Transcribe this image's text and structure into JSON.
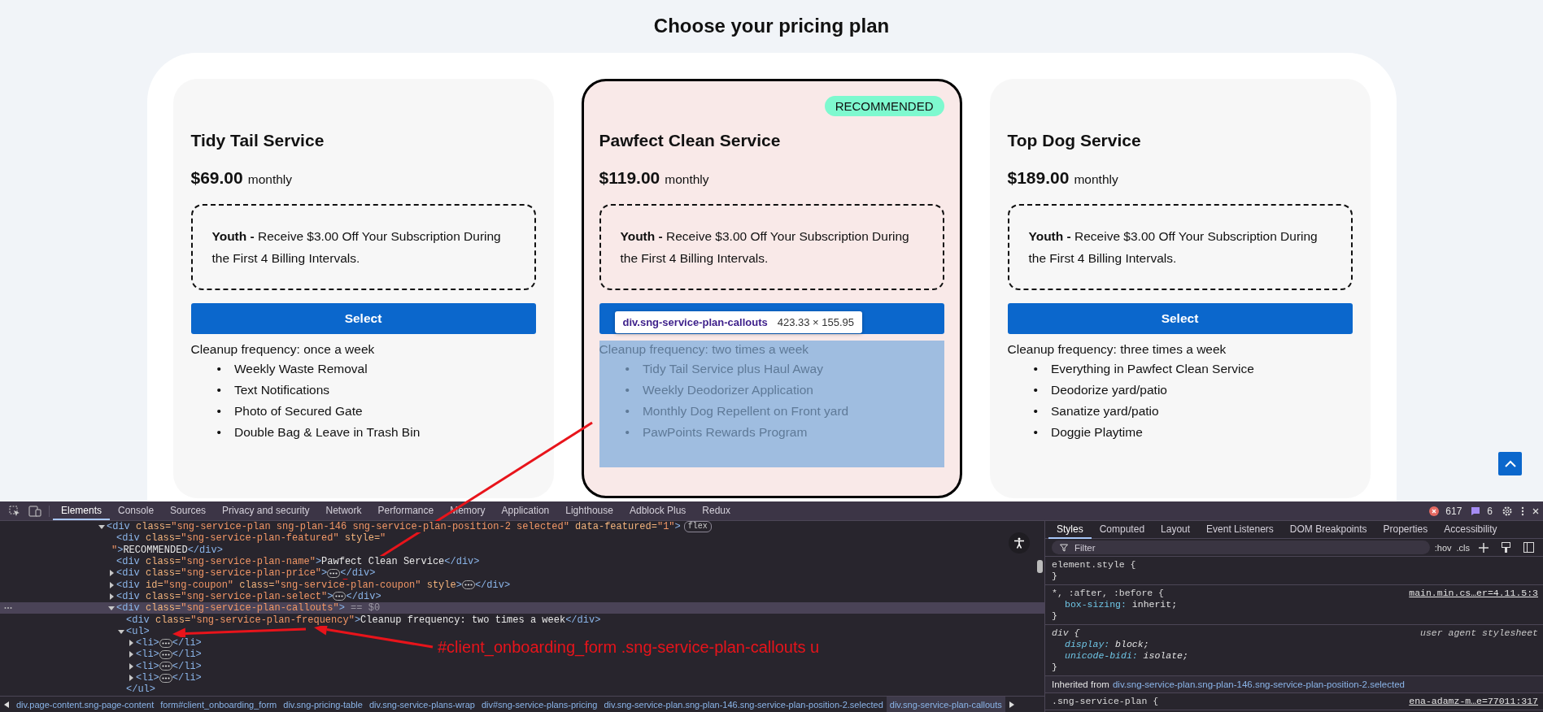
{
  "page": {
    "title": "Choose your pricing plan"
  },
  "plans": [
    {
      "name": "Tidy Tail Service",
      "price": "$69.00",
      "period": "monthly",
      "selected": false,
      "inspected": false,
      "coupon": "**Youth -** Receive $3.00 Off Your Subscription During the First 4 Billing Intervals.",
      "select_label": "Select",
      "frequency": "Cleanup frequency: once a week",
      "features": [
        {
          "bullet": "•",
          "text": "Weekly Waste Removal"
        },
        {
          "bullet": "•",
          "text": "Text Notifications"
        },
        {
          "bullet": "•",
          "text": "Photo of Secured Gate"
        },
        {
          "bullet": "•",
          "text": "Double Bag & Leave in Trash Bin"
        }
      ]
    },
    {
      "name": "Pawfect Clean Service",
      "price": "$119.00",
      "period": "monthly",
      "badge": "RECOMMENDED",
      "selected": true,
      "inspected": true,
      "coupon": "**Youth -** Receive $3.00 Off Your Subscription During the First 4 Billing Intervals.",
      "frequency": "Cleanup frequency: two times a week",
      "features": [
        {
          "bullet": "•",
          "text": "Tidy Tail Service plus Haul Away"
        },
        {
          "bullet": "•",
          "text": "Weekly Deodorizer Application"
        },
        {
          "bullet": "•",
          "text": "Monthly Dog Repellent on Front yard"
        },
        {
          "bullet": "•",
          "text": "PawPoints Rewards Program"
        }
      ]
    },
    {
      "name": "Top Dog Service",
      "price": "$189.00",
      "period": "monthly",
      "selected": false,
      "inspected": false,
      "coupon": "**Youth -** Receive $3.00 Off Your Subscription During the First 4 Billing Intervals.",
      "select_label": "Select",
      "frequency": "Cleanup frequency: three times a week",
      "features": [
        {
          "bullet": "•",
          "text": "Everything in Pawfect Clean Service"
        },
        {
          "bullet": "•",
          "text": "Deodorize yard/patio"
        },
        {
          "bullet": "•",
          "text": "Sanatize yard/patio"
        },
        {
          "bullet": "•",
          "text": "Doggie Playtime"
        }
      ]
    }
  ],
  "inspector_tooltip": {
    "selector": "div.sng-service-plan-callouts",
    "size": "423.33 × 155.95"
  },
  "annotation": {
    "text": "#client_onboarding_form .sng-service-plan-callouts u"
  },
  "devtools": {
    "tabs": [
      {
        "label": "Elements",
        "selected": true
      },
      {
        "label": "Console",
        "selected": false
      },
      {
        "label": "Sources",
        "selected": false
      },
      {
        "label": "Privacy and security",
        "selected": false
      },
      {
        "label": "Network",
        "selected": false
      },
      {
        "label": "Performance",
        "selected": false
      },
      {
        "label": "Memory",
        "selected": false
      },
      {
        "label": "Application",
        "selected": false
      },
      {
        "label": "Lighthouse",
        "selected": false
      },
      {
        "label": "Adblock Plus",
        "selected": false
      },
      {
        "label": "Redux",
        "selected": false
      }
    ],
    "error_count": "617",
    "message_count": "6",
    "dom_tree": [
      {
        "expanded": true,
        "selected": false,
        "lines": [
          [
            {
              "kind": "tag",
              "t": "<div"
            },
            {
              "kind": "attr",
              "t": " class="
            },
            {
              "kind": "value",
              "t": "\"sng-service-plan sng-plan-146 sng-service-plan-position-2 selected\""
            },
            {
              "kind": "attr",
              "t": " data-featured="
            },
            {
              "kind": "value",
              "t": "\"1\""
            },
            {
              "kind": "tag",
              "t": ">"
            },
            {
              "kind": "badge",
              "t": "flex"
            }
          ]
        ],
        "children": [
          {
            "selected": false,
            "lines": [
              [
                {
                  "kind": "tag",
                  "t": "<div"
                },
                {
                  "kind": "attr",
                  "t": " class="
                },
                {
                  "kind": "value",
                  "t": "\"sng-service-plan-featured\""
                },
                {
                  "kind": "attr",
                  "t": " style="
                },
                {
                  "kind": "value",
                  "t": "\""
                }
              ],
              [
                {
                  "kind": "value",
                  "t": "\""
                },
                {
                  "kind": "tag",
                  "t": ">"
                },
                {
                  "kind": "text",
                  "t": "RECOMMENDED"
                },
                {
                  "kind": "tag",
                  "t": "</div>"
                }
              ]
            ]
          },
          {
            "selected": false,
            "lines": [
              [
                {
                  "kind": "tag",
                  "t": "<div"
                },
                {
                  "kind": "attr",
                  "t": " class="
                },
                {
                  "kind": "value",
                  "t": "\"sng-service-plan-name\""
                },
                {
                  "kind": "tag",
                  "t": ">"
                },
                {
                  "kind": "text",
                  "t": "Pawfect Clean Service"
                },
                {
                  "kind": "tag",
                  "t": "</div>"
                }
              ]
            ]
          },
          {
            "expanded": false,
            "selected": false,
            "lines": [
              [
                {
                  "kind": "tag",
                  "t": "<div"
                },
                {
                  "kind": "attr",
                  "t": " class="
                },
                {
                  "kind": "value",
                  "t": "\"sng-service-plan-price\""
                },
                {
                  "kind": "tag",
                  "t": ">"
                },
                {
                  "kind": "more"
                },
                {
                  "kind": "tag",
                  "t": "</div>"
                }
              ]
            ]
          },
          {
            "expanded": false,
            "selected": false,
            "lines": [
              [
                {
                  "kind": "tag",
                  "t": "<div"
                },
                {
                  "kind": "attr",
                  "t": " id="
                },
                {
                  "kind": "value",
                  "t": "\"sng-coupon\""
                },
                {
                  "kind": "attr",
                  "t": " class="
                },
                {
                  "kind": "value",
                  "t": "\"sng-service-plan-coupon\""
                },
                {
                  "kind": "attr",
                  "t": " style"
                },
                {
                  "kind": "tag",
                  "t": ">"
                },
                {
                  "kind": "more"
                },
                {
                  "kind": "tag",
                  "t": "</div>"
                }
              ]
            ]
          },
          {
            "expanded": false,
            "selected": false,
            "lines": [
              [
                {
                  "kind": "tag",
                  "t": "<div"
                },
                {
                  "kind": "attr",
                  "t": " class="
                },
                {
                  "kind": "value",
                  "t": "\"sng-service-plan-select\""
                },
                {
                  "kind": "tag",
                  "t": ">"
                },
                {
                  "kind": "more"
                },
                {
                  "kind": "tag",
                  "t": "</div>"
                }
              ]
            ]
          },
          {
            "expanded": true,
            "selected": true,
            "lines": [
              [
                {
                  "kind": "tag",
                  "t": "<div"
                },
                {
                  "kind": "attr",
                  "t": " class="
                },
                {
                  "kind": "value",
                  "t": "\"sng-service-plan-callouts\""
                },
                {
                  "kind": "tag",
                  "t": ">"
                },
                {
                  "kind": "dim",
                  "t": " == $0"
                }
              ]
            ],
            "children": [
              {
                "selected": false,
                "lines": [
                  [
                    {
                      "kind": "tag",
                      "t": "<div"
                    },
                    {
                      "kind": "attr",
                      "t": " class="
                    },
                    {
                      "kind": "value",
                      "t": "\"sng-service-plan-frequency\""
                    },
                    {
                      "kind": "tag",
                      "t": ">"
                    },
                    {
                      "kind": "text",
                      "t": "Cleanup frequency: two times a week"
                    },
                    {
                      "kind": "tag",
                      "t": "</div>"
                    }
                  ]
                ]
              },
              {
                "expanded": true,
                "selected": false,
                "lines": [
                  [
                    {
                      "kind": "tag",
                      "t": "<ul>"
                    }
                  ]
                ],
                "close": [
                  {
                    "kind": "tag",
                    "t": "</ul>"
                  }
                ],
                "children": [
                  {
                    "expanded": false,
                    "selected": false,
                    "lines": [
                      [
                        {
                          "kind": "tag",
                          "t": "<li>"
                        },
                        {
                          "kind": "more"
                        },
                        {
                          "kind": "tag",
                          "t": "</li>"
                        }
                      ]
                    ]
                  },
                  {
                    "expanded": false,
                    "selected": false,
                    "lines": [
                      [
                        {
                          "kind": "tag",
                          "t": "<li>"
                        },
                        {
                          "kind": "more"
                        },
                        {
                          "kind": "tag",
                          "t": "</li>"
                        }
                      ]
                    ]
                  },
                  {
                    "expanded": false,
                    "selected": false,
                    "lines": [
                      [
                        {
                          "kind": "tag",
                          "t": "<li>"
                        },
                        {
                          "kind": "more"
                        },
                        {
                          "kind": "tag",
                          "t": "</li>"
                        }
                      ]
                    ]
                  },
                  {
                    "expanded": false,
                    "selected": false,
                    "lines": [
                      [
                        {
                          "kind": "tag",
                          "t": "<li>"
                        },
                        {
                          "kind": "more"
                        },
                        {
                          "kind": "tag",
                          "t": "</li>"
                        }
                      ]
                    ]
                  }
                ]
              }
            ]
          }
        ]
      }
    ],
    "breadcrumbs": [
      {
        "label": "div.page-content.sng-page-content",
        "selected": false
      },
      {
        "label": "form#client_onboarding_form",
        "selected": false
      },
      {
        "label": "div.sng-pricing-table",
        "selected": false
      },
      {
        "label": "div.sng-service-plans-wrap",
        "selected": false
      },
      {
        "label": "div#sng-service-plans-pricing",
        "selected": false
      },
      {
        "label": "div.sng-service-plan.sng-plan-146.sng-service-plan-position-2.selected",
        "selected": false
      },
      {
        "label": "div.sng-service-plan-callouts",
        "selected": true
      }
    ],
    "styles_tabs": [
      {
        "label": "Styles",
        "selected": true
      },
      {
        "label": "Computed",
        "selected": false
      },
      {
        "label": "Layout",
        "selected": false
      },
      {
        "label": "Event Listeners",
        "selected": false
      },
      {
        "label": "DOM Breakpoints",
        "selected": false
      },
      {
        "label": "Properties",
        "selected": false
      },
      {
        "label": "Accessibility",
        "selected": false
      }
    ],
    "filter": {
      "placeholder": "Filter"
    },
    "style_tools": [
      ":hov",
      ".cls"
    ],
    "rules": [
      {
        "kind": "rule",
        "user_agent": false,
        "selector": "element.style {",
        "close": "}"
      },
      {
        "kind": "rule",
        "user_agent": false,
        "selector": "*, :after, :before {",
        "source": "main.min.cs…er=4.11.5:3",
        "declarations": [
          {
            "property": "box-sizing:",
            "value": " inherit;"
          }
        ],
        "close": "}"
      },
      {
        "kind": "rule",
        "user_agent": true,
        "selector": "div {",
        "source": "user agent stylesheet",
        "declarations": [
          {
            "property": "display:",
            "value": " block;"
          },
          {
            "property": "unicode-bidi:",
            "value": " isolate;"
          }
        ],
        "close": "}"
      },
      {
        "kind": "inherited",
        "label": "Inherited from",
        "link": "div.sng-service-plan.sng-plan-146.sng-service-plan-position-2.selected"
      },
      {
        "kind": "rule",
        "user_agent": false,
        "selector": ".sng-service-plan {",
        "source": "ena-adamz-m…e=77011:317"
      }
    ]
  }
}
